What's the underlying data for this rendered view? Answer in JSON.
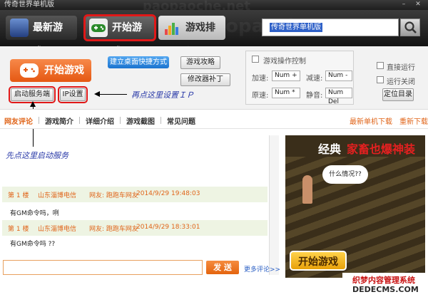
{
  "window": {
    "title": "传奇世界单机版",
    "watermark": "paopaoche.net"
  },
  "nav": {
    "new_games": "最新游戏",
    "start_game": "开始游戏",
    "ranking": "游戏排行",
    "search_value": "传奇世界单机版"
  },
  "controls": {
    "start_game": "开始游戏",
    "create_shortcut": "建立桌面快捷方式",
    "strategy": "游戏攻略",
    "patch": "修改器补丁",
    "start_server": "启动服务端",
    "ip_settings": "IP设置",
    "open_dir": "定位目录"
  },
  "panel": {
    "title": "游戏操作控制",
    "speed_up_label": "加速:",
    "speed_up_key": "Num +",
    "slow_down_label": "减速:",
    "slow_down_key": "Num -",
    "original_label": "原速:",
    "original_key": "Num *",
    "mute_label": "静音:",
    "mute_key": "Num Del",
    "direct_run": "直接运行",
    "close_after_run": "运行关闭"
  },
  "annotations": {
    "ip": "再点这里设置ＩＰ",
    "server": "先点这里启动服务"
  },
  "tabs": {
    "items": [
      "网友评论",
      "游戏简介",
      "详细介绍",
      "游戏截图",
      "常见问题"
    ],
    "latest_download": "最新单机下载",
    "redownload": "重新下载"
  },
  "comments": [
    {
      "floor": "第 1 楼",
      "location": "山东淄博电信",
      "user": "网友: 跑跑车网友",
      "time": "2014/9/29 19:48:03",
      "text": "有GM命令吗，咧"
    },
    {
      "floor": "第 1 楼",
      "location": "山东淄博电信",
      "user": "网友: 跑跑车网友",
      "time": "2014/9/29 18:33:01",
      "text": "有GM命令吗 ??"
    }
  ],
  "comment_form": {
    "send": "发 送",
    "more": "更多评论>>"
  },
  "ad": {
    "title_white": "经典",
    "title_red": "家畜也爆神装",
    "bubble": "什么情况??",
    "play": "开始游戏"
  },
  "logo": {
    "line1": "织梦内容管理系统",
    "line2": "DEDECMS.COM"
  },
  "colors": {
    "accent_orange": "#e0651a",
    "highlight_red": "#e01818",
    "link_blue": "#2a5fc4"
  }
}
